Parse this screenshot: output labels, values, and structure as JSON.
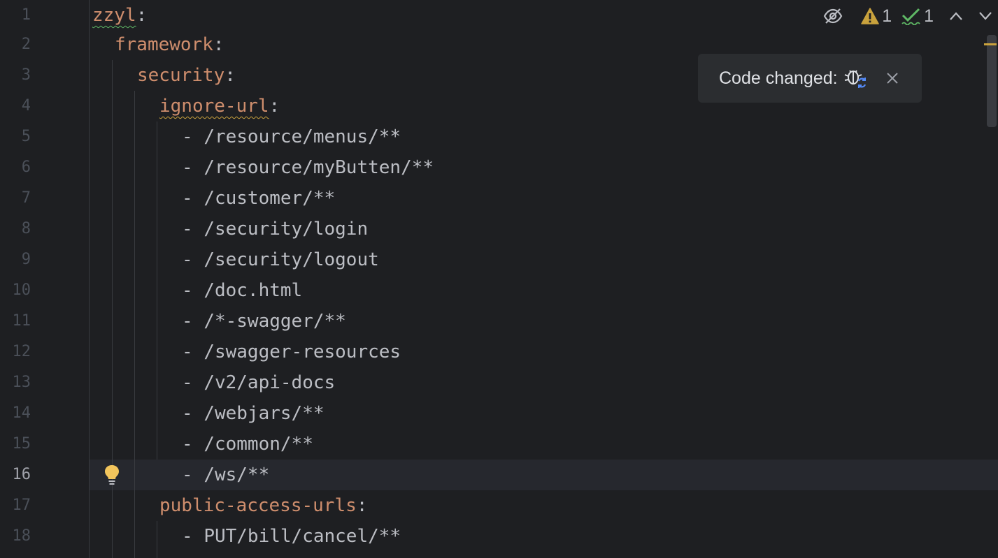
{
  "editor": {
    "current_line": 16,
    "line_numbers": [
      "1",
      "2",
      "3",
      "4",
      "5",
      "6",
      "7",
      "8",
      "9",
      "10",
      "11",
      "12",
      "13",
      "14",
      "15",
      "16",
      "17",
      "18"
    ],
    "lines": [
      {
        "indent": "",
        "key": "zzyl",
        "colon": ":"
      },
      {
        "indent": "  ",
        "key": "framework",
        "colon": ":"
      },
      {
        "indent": "    ",
        "key": "security",
        "colon": ":"
      },
      {
        "indent": "      ",
        "key": "ignore-url",
        "colon": ":"
      },
      {
        "indent": "        ",
        "dash": "- ",
        "value": "/resource/menus/**"
      },
      {
        "indent": "        ",
        "dash": "- ",
        "value": "/resource/myButten/**"
      },
      {
        "indent": "        ",
        "dash": "- ",
        "value": "/customer/**"
      },
      {
        "indent": "        ",
        "dash": "- ",
        "value": "/security/login"
      },
      {
        "indent": "        ",
        "dash": "- ",
        "value": "/security/logout"
      },
      {
        "indent": "        ",
        "dash": "- ",
        "value": "/doc.html"
      },
      {
        "indent": "        ",
        "dash": "- ",
        "value": "/*-swagger/**"
      },
      {
        "indent": "        ",
        "dash": "- ",
        "value": "/swagger-resources"
      },
      {
        "indent": "        ",
        "dash": "- ",
        "value": "/v2/api-docs"
      },
      {
        "indent": "        ",
        "dash": "- ",
        "value": "/webjars/**"
      },
      {
        "indent": "        ",
        "dash": "- ",
        "value": "/common/**"
      },
      {
        "indent": "        ",
        "dash": "- ",
        "value": "/ws/**"
      },
      {
        "indent": "      ",
        "key": "public-access-urls",
        "colon": ":"
      },
      {
        "indent": "        ",
        "dash": "- ",
        "value": "PUT/bill/cancel/**"
      }
    ]
  },
  "inspections": {
    "warnings_count": "1",
    "typos_count": "1"
  },
  "popup": {
    "label": "Code changed:"
  },
  "colors": {
    "background": "#1e1f22",
    "key": "#cf8e6d",
    "text": "#bcbec4",
    "warning": "#c9a23d",
    "typo": "#5fb865",
    "current_line": "#26282e"
  }
}
